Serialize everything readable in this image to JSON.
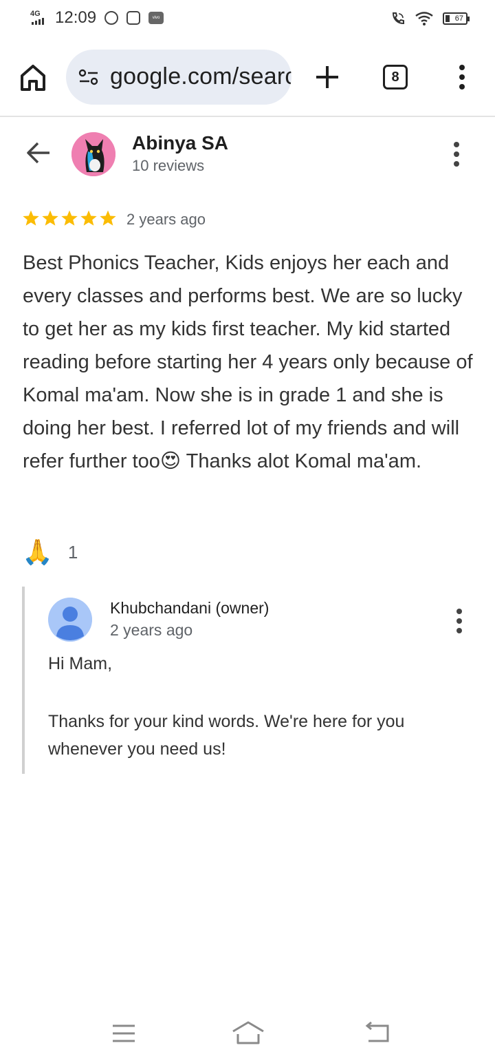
{
  "status_bar": {
    "network": "4G",
    "time": "12:09",
    "battery": "67"
  },
  "browser": {
    "url": "google.com/search",
    "tab_count": "8"
  },
  "review": {
    "reviewer_name": "Abinya SA",
    "reviewer_reviews": "10 reviews",
    "rating": 5,
    "date": "2 years ago",
    "text": "Best Phonics Teacher, Kids enjoys her each and every classes and performs best. We are so lucky to get her as my kids first teacher. My kid started reading before starting her 4 years only because of Komal ma'am. Now she is in grade 1 and she is doing her best. I referred lot of my friends and will refer further too😍 Thanks alot Komal ma'am.",
    "reaction_emoji": "🙏",
    "reaction_count": "1"
  },
  "reply": {
    "owner_name": "Khubchandani (owner)",
    "date": "2 years ago",
    "greeting": "Hi Mam,",
    "body": "Thanks for your kind words. We're here for you whenever you need us!"
  },
  "colors": {
    "star": "#fbbc04",
    "url_bar_bg": "#e8ecf4",
    "owner_avatar": "#a9c7f8",
    "owner_avatar_figure": "#4a7fe0",
    "reviewer_avatar": "#ef7fb1"
  }
}
